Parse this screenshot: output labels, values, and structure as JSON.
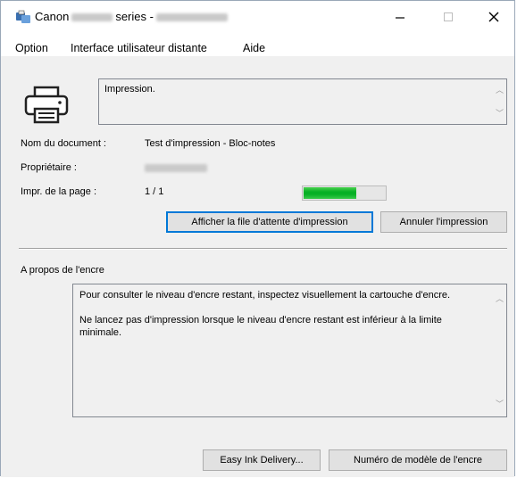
{
  "window": {
    "title_prefix": "Canon",
    "title_series": "series -",
    "minimize": "–",
    "maximize": "□",
    "close": "✕"
  },
  "menu": {
    "items": [
      "Option",
      "Interface utilisateur distante",
      "Aide"
    ]
  },
  "status": {
    "message": "Impression."
  },
  "fields": {
    "document_label": "Nom du document :",
    "document_value": "Test d'impression - Bloc-notes",
    "owner_label": "Propriétaire :",
    "page_label": "Impr. de la page :",
    "page_value": "1 / 1"
  },
  "progress": {
    "fraction": 0.65
  },
  "buttons": {
    "queue": "Afficher la file d'attente d'impression",
    "cancel": "Annuler l'impression",
    "easy_ink": "Easy Ink Delivery...",
    "ink_model": "Numéro de modèle de l'encre"
  },
  "ink": {
    "section_title": "A propos de l'encre",
    "paragraph1": "Pour consulter le niveau d'encre restant, inspectez visuellement la cartouche d'encre.",
    "paragraph2": "Ne lancez pas d'impression lorsque le niveau d'encre restant est inférieur à la limite minimale."
  },
  "colors": {
    "progress_fill": "#06b025",
    "default_button_border": "#0078d7"
  }
}
